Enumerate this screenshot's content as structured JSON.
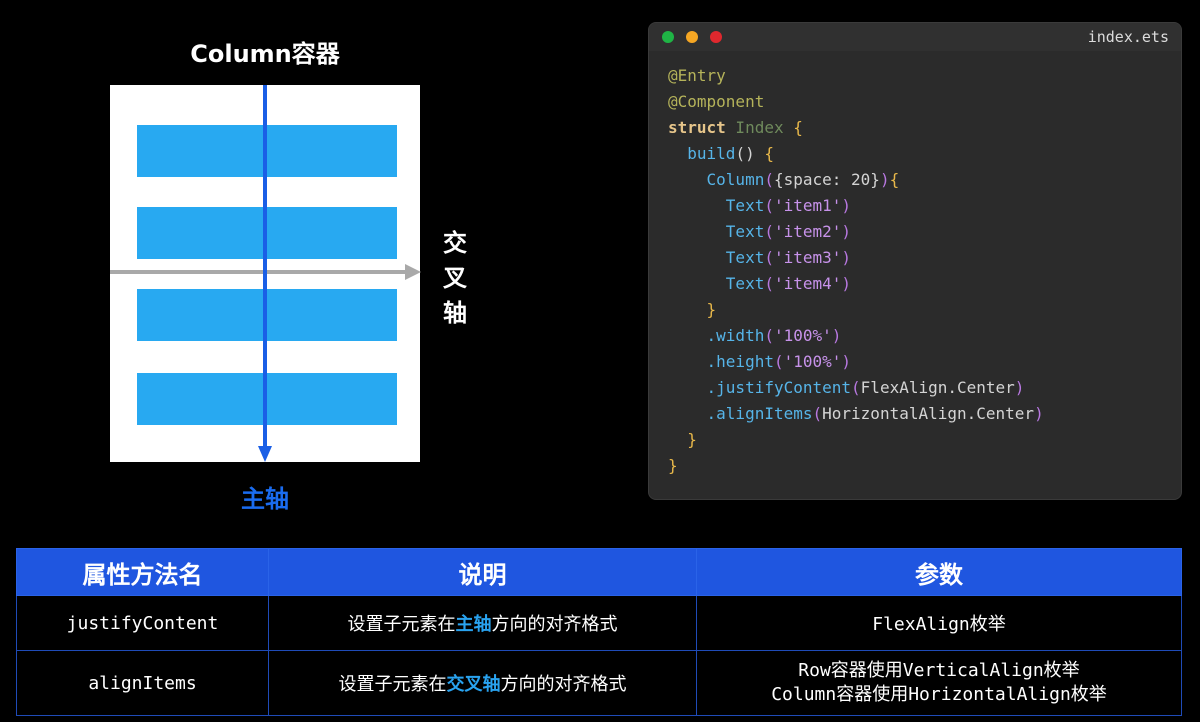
{
  "diagram": {
    "title": "Column容器",
    "cross_axis_chars": [
      "交",
      "叉",
      "轴"
    ],
    "main_axis_label": "主轴",
    "item_count": 4,
    "colors": {
      "item": "#28a9f1",
      "main_axis": "#1a5fe6",
      "cross_axis": "#a9a9a9"
    }
  },
  "code": {
    "file_name": "index.ets",
    "lines": [
      [
        {
          "t": "@Entry",
          "c": "deco"
        }
      ],
      [
        {
          "t": "@Component",
          "c": "deco"
        }
      ],
      [
        {
          "t": "struct",
          "c": "kw"
        },
        {
          "t": " Index ",
          "c": "type"
        },
        {
          "t": "{",
          "c": "brace"
        }
      ],
      [
        {
          "t": "  build",
          "c": "fn"
        },
        {
          "t": "() ",
          "c": "plain"
        },
        {
          "t": "{",
          "c": "brace"
        }
      ],
      [
        {
          "t": "    Column",
          "c": "fn"
        },
        {
          "t": "(",
          "c": "paren"
        },
        {
          "t": "{space: 20}",
          "c": "plain"
        },
        {
          "t": ")",
          "c": "paren"
        },
        {
          "t": "{",
          "c": "brace"
        }
      ],
      [
        {
          "t": "      Text",
          "c": "fn"
        },
        {
          "t": "(",
          "c": "paren"
        },
        {
          "t": "'item1'",
          "c": "str"
        },
        {
          "t": ")",
          "c": "paren"
        }
      ],
      [
        {
          "t": "      Text",
          "c": "fn"
        },
        {
          "t": "(",
          "c": "paren"
        },
        {
          "t": "'item2'",
          "c": "str"
        },
        {
          "t": ")",
          "c": "paren"
        }
      ],
      [
        {
          "t": "      Text",
          "c": "fn"
        },
        {
          "t": "(",
          "c": "paren"
        },
        {
          "t": "'item3'",
          "c": "str"
        },
        {
          "t": ")",
          "c": "paren"
        }
      ],
      [
        {
          "t": "      Text",
          "c": "fn"
        },
        {
          "t": "(",
          "c": "paren"
        },
        {
          "t": "'item4'",
          "c": "str"
        },
        {
          "t": ")",
          "c": "paren"
        }
      ],
      [
        {
          "t": "    }",
          "c": "brace"
        }
      ],
      [
        {
          "t": "    .width",
          "c": "method"
        },
        {
          "t": "(",
          "c": "paren"
        },
        {
          "t": "'100%'",
          "c": "str"
        },
        {
          "t": ")",
          "c": "paren"
        }
      ],
      [
        {
          "t": "    .height",
          "c": "method"
        },
        {
          "t": "(",
          "c": "paren"
        },
        {
          "t": "'100%'",
          "c": "str"
        },
        {
          "t": ")",
          "c": "paren"
        }
      ],
      [
        {
          "t": "    .justifyContent",
          "c": "method"
        },
        {
          "t": "(",
          "c": "paren"
        },
        {
          "t": "FlexAlign.Center",
          "c": "plain"
        },
        {
          "t": ")",
          "c": "paren"
        }
      ],
      [
        {
          "t": "    .alignItems",
          "c": "method"
        },
        {
          "t": "(",
          "c": "paren"
        },
        {
          "t": "HorizontalAlign.Center",
          "c": "plain"
        },
        {
          "t": ")",
          "c": "paren"
        }
      ],
      [
        {
          "t": "  }",
          "c": "brace"
        }
      ],
      [
        {
          "t": "}",
          "c": "brace"
        }
      ]
    ]
  },
  "table": {
    "headers": [
      "属性方法名",
      "说明",
      "参数"
    ],
    "rows": [
      {
        "name": "justifyContent",
        "desc_prefix": "设置子元素在",
        "desc_highlight": "主轴",
        "desc_suffix": "方向的对齐格式",
        "param_lines": [
          "FlexAlign枚举"
        ]
      },
      {
        "name": "alignItems",
        "desc_prefix": "设置子元素在",
        "desc_highlight": "交叉轴",
        "desc_suffix": "方向的对齐格式",
        "param_lines": [
          "Row容器使用VerticalAlign枚举",
          "Column容器使用HorizontalAlign枚举"
        ]
      }
    ]
  }
}
